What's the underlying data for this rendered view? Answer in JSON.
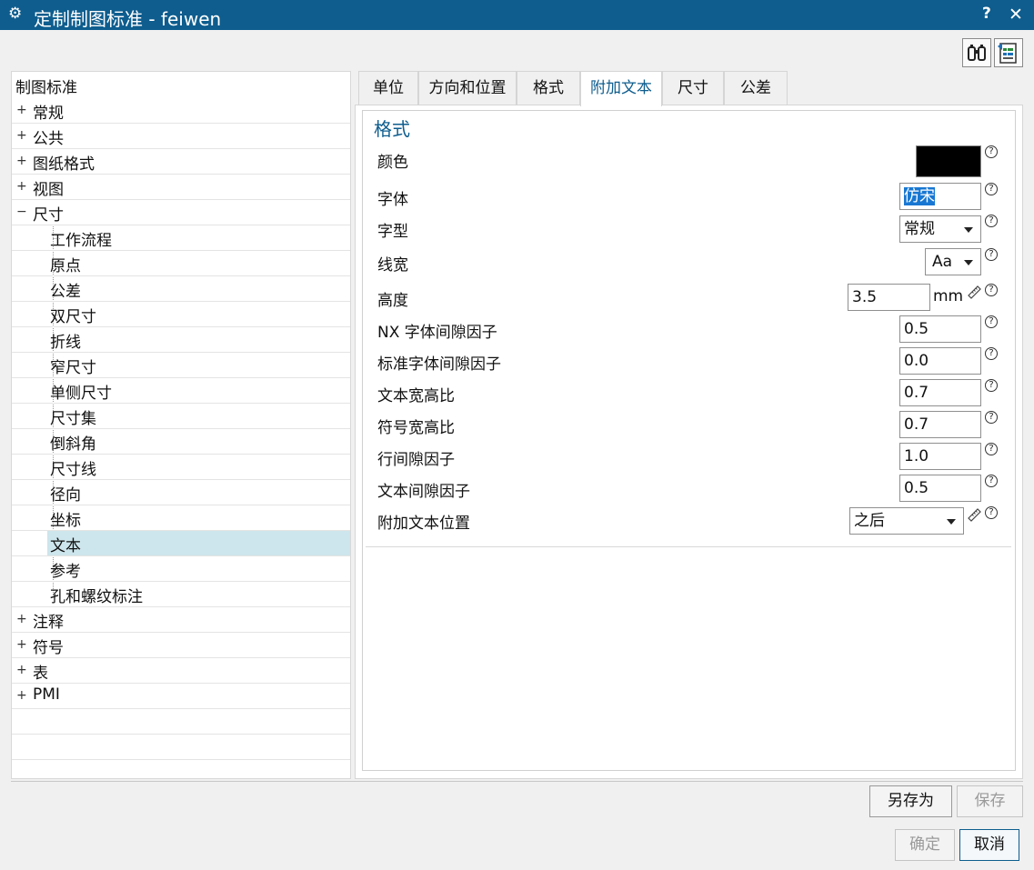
{
  "window": {
    "title": "定制制图标准 - feiwen",
    "help": "?",
    "close": "✕"
  },
  "tree": {
    "root": "制图标准",
    "groups_before": [
      {
        "label": "常规",
        "expander": "+"
      },
      {
        "label": "公共",
        "expander": "+"
      },
      {
        "label": "图纸格式",
        "expander": "+"
      },
      {
        "label": "视图",
        "expander": "+"
      }
    ],
    "expanded": {
      "label": "尺寸",
      "expander": "−"
    },
    "children": [
      "工作流程",
      "原点",
      "公差",
      "双尺寸",
      "折线",
      "窄尺寸",
      "单侧尺寸",
      "尺寸集",
      "倒斜角",
      "尺寸线",
      "径向",
      "坐标",
      "文本",
      "参考",
      "孔和螺纹标注"
    ],
    "selected_child": "文本",
    "groups_after": [
      {
        "label": "注释",
        "expander": "+"
      },
      {
        "label": "符号",
        "expander": "+"
      },
      {
        "label": "表",
        "expander": "+"
      },
      {
        "label": "PMI",
        "expander": "+"
      }
    ]
  },
  "tabs": [
    "单位",
    "方向和位置",
    "格式",
    "附加文本",
    "尺寸",
    "公差"
  ],
  "active_tab": "附加文本",
  "section": {
    "title": "格式",
    "color_label": "颜色",
    "color_value": "#000000",
    "font_label": "字体",
    "font_value": "仿宋",
    "style_label": "字型",
    "style_value": "常规",
    "linewidth_label": "线宽",
    "linewidth_value": "Aa",
    "height_label": "高度",
    "height_value": "3.5",
    "height_unit": "mm",
    "nx_gap_label": "NX 字体间隙因子",
    "nx_gap_value": "0.5",
    "std_gap_label": "标准字体间隙因子",
    "std_gap_value": "0.0",
    "text_ratio_label": "文本宽高比",
    "text_ratio_value": "0.7",
    "symbol_ratio_label": "符号宽高比",
    "symbol_ratio_value": "0.7",
    "line_gap_label": "行间隙因子",
    "line_gap_value": "1.0",
    "text_gap_label": "文本间隙因子",
    "text_gap_value": "0.5",
    "position_label": "附加文本位置",
    "position_value": "之后",
    "help_glyph": "?"
  },
  "buttons": {
    "save_as": "另存为",
    "save": "保存",
    "ok": "确定",
    "cancel": "取消"
  }
}
